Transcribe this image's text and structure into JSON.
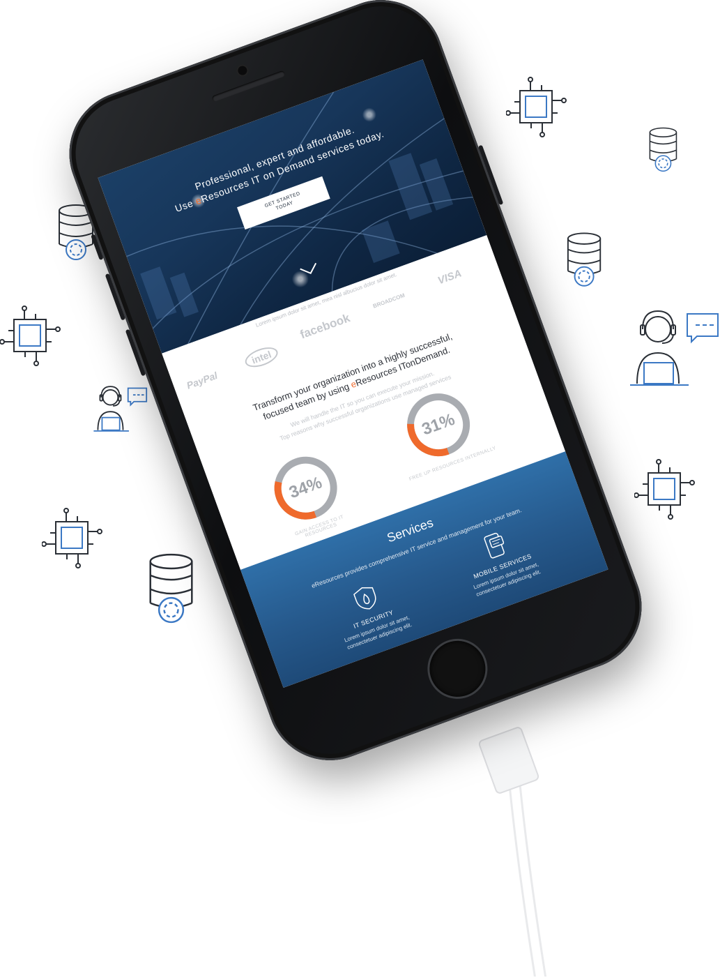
{
  "hero": {
    "line1": "Professional, expert and affordable.",
    "line2_pre": "Use ",
    "line2_e": "e",
    "line2_post": "Resources IT on Demand services today.",
    "cta_line1": "GET STARTED",
    "cta_line2": "TODAY"
  },
  "logos": {
    "lorem": "Lorem ipsum dolor sit amet, mea nisl albucius dolor sit amet.",
    "items": [
      "PayPal",
      "intel",
      "facebook",
      "BROADCOM",
      "VISA"
    ]
  },
  "transform": {
    "line1": "Transform your organization into a highly successful,",
    "line2_pre": "focused team by using ",
    "line2_e": "e",
    "line2_post": "Resources ITonDemand.",
    "sub1": "We will handle the IT so you can execute your mission.",
    "sub2": "Top reasons why successful organizations use managed services",
    "stats": [
      {
        "value": "34%",
        "fraction": 0.34,
        "caption1": "GAIN ACCESS TO IT",
        "caption2": "RESOURCES"
      },
      {
        "value": "31%",
        "fraction": 0.31,
        "caption1": "FREE UP RESOURCES INTERNALLY",
        "caption2": ""
      }
    ]
  },
  "services": {
    "title": "Services",
    "description": "eResources provides comprehensive IT service and management for your team.",
    "items": [
      {
        "name": "IT SECURITY",
        "text1": "Lorem ipsum dolor sit amet,",
        "text2": "consectetuer adipiscing elit."
      },
      {
        "name": "MOBILE SERVICES",
        "text1": "Lorem ipsum dolor sit amet,",
        "text2": "consectetuer adipiscing elit."
      }
    ]
  },
  "colors": {
    "accent": "#ef6a2c",
    "donut_track": "#a9acb1",
    "icon_line": "#2a2f36",
    "icon_blue": "#3b78c4",
    "services_bg": "#2a6399"
  },
  "icons": [
    "chip-icon",
    "database-sync-icon",
    "support-agent-icon",
    "shield-fire-icon",
    "mobile-chat-icon",
    "chevron-down-icon"
  ]
}
